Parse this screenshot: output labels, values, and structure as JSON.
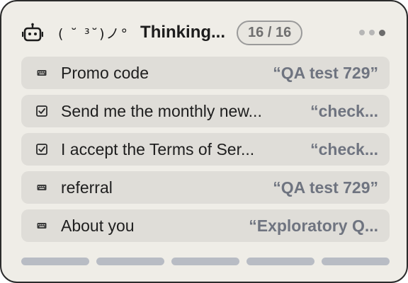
{
  "header": {
    "robot_icon": "robot-icon",
    "kaomoji": "( ˘ ³˘)ノ°",
    "title": "Thinking...",
    "counter": "16 / 16"
  },
  "progress_dots": {
    "count": 3,
    "active_index": 2
  },
  "fields": [
    {
      "icon": "keyboard-icon",
      "label": "Promo code",
      "value": "“QA test 729”"
    },
    {
      "icon": "checkbox-icon",
      "label": "Send me the monthly new...",
      "value": "“check..."
    },
    {
      "icon": "checkbox-icon",
      "label": "I accept the Terms of Ser...",
      "value": "“check..."
    },
    {
      "icon": "keyboard-icon",
      "label": "referral",
      "value": "“QA test 729”"
    },
    {
      "icon": "keyboard-icon",
      "label": "About you",
      "value": "“Exploratory Q..."
    }
  ],
  "step_bars": {
    "count": 5,
    "completed": 5
  },
  "colors": {
    "panel_bg": "#efede7",
    "row_bg": "#dfddd8",
    "value_text": "#6f7480",
    "bar": "#b8bcc4"
  }
}
